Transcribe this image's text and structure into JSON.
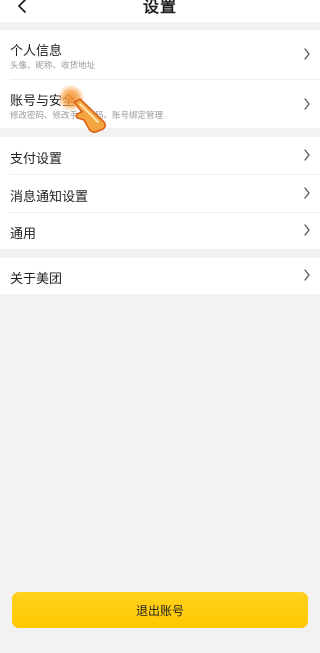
{
  "header": {
    "title": "设置",
    "back_icon": "chevron-left-icon"
  },
  "groups": [
    {
      "items": [
        {
          "title": "个人信息",
          "subtitle": "头像、昵称、收货地址"
        },
        {
          "title": "账号与安全",
          "subtitle": "修改密码、修改手机号码、账号绑定管理"
        }
      ]
    },
    {
      "items": [
        {
          "title": "支付设置"
        },
        {
          "title": "消息通知设置"
        },
        {
          "title": "通用"
        }
      ]
    },
    {
      "items": [
        {
          "title": "关于美团"
        }
      ]
    }
  ],
  "logout_label": "退出账号",
  "colors": {
    "accent": "#ffcb05",
    "background": "#f2f2f2",
    "tap_overlay": "#f5902a"
  }
}
